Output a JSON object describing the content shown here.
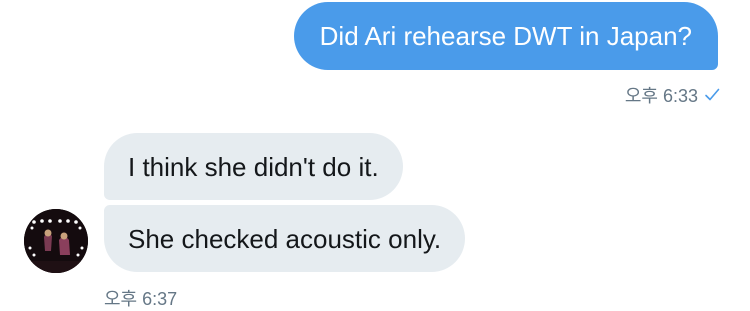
{
  "conversation": {
    "outgoing": {
      "text": "Did Ari rehearse DWT in Japan?",
      "time": "오후 6:33",
      "status_icon": "checkmark-icon",
      "bubble_color": "#4a9bea"
    },
    "incoming": {
      "messages": [
        {
          "text": "I think she didn't do it."
        },
        {
          "text": "She checked acoustic only."
        }
      ],
      "time": "오후 6:37",
      "bubble_color": "#e6ecf0"
    }
  }
}
